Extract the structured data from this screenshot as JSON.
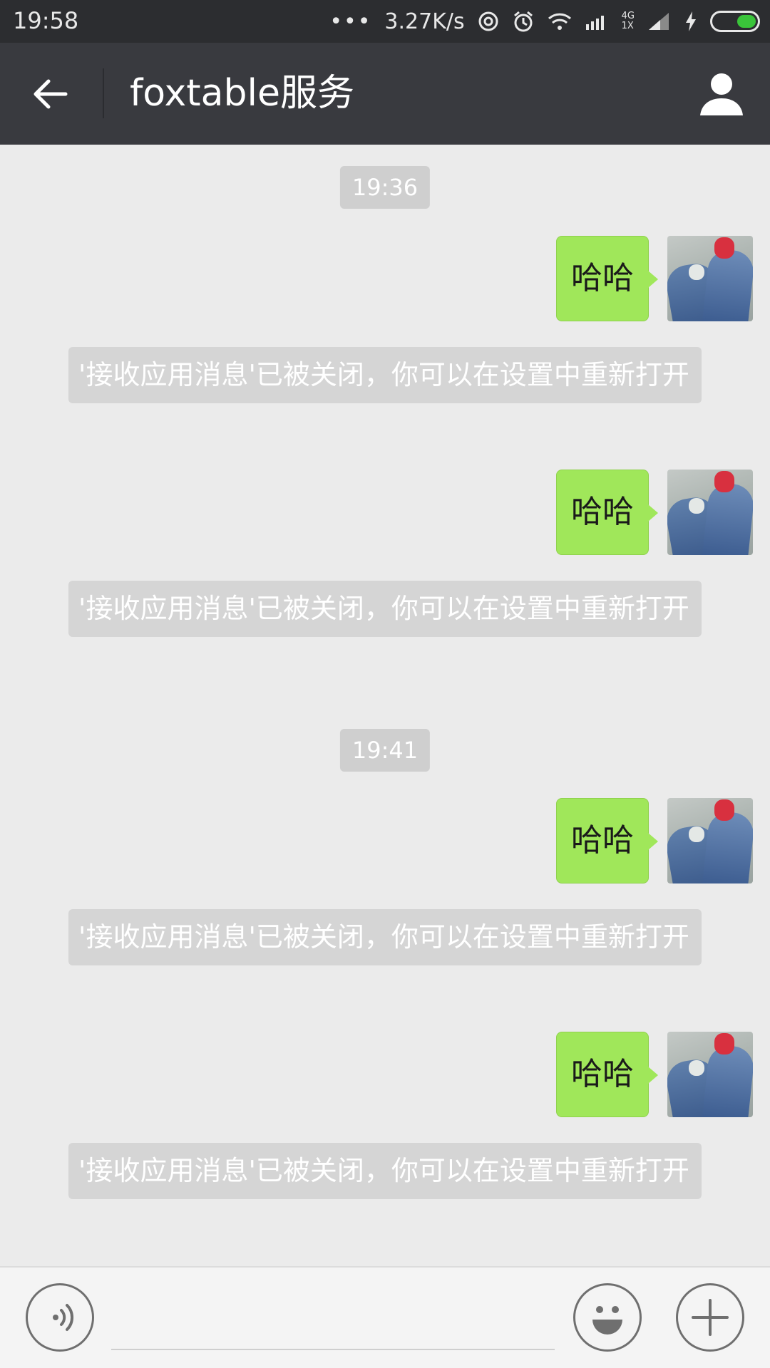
{
  "status_bar": {
    "time": "19:58",
    "dots": "•••",
    "net_speed": "3.27K/s",
    "net_type": "4G",
    "net_sub": "1X"
  },
  "header": {
    "title": "foxtable服务"
  },
  "chat": {
    "timestamps": [
      "19:36",
      "19:41"
    ],
    "messages": [
      {
        "text": "哈哈"
      },
      {
        "note": "'接收应用消息'已被关闭，你可以在设置中重新打开"
      },
      {
        "text": "哈哈"
      },
      {
        "note": "'接收应用消息'已被关闭，你可以在设置中重新打开"
      },
      {
        "text": "哈哈"
      },
      {
        "note": "'接收应用消息'已被关闭，你可以在设置中重新打开"
      },
      {
        "text": "哈哈"
      },
      {
        "note": "'接收应用消息'已被关闭，你可以在设置中重新打开"
      }
    ]
  },
  "input_bar": {
    "message_value": ""
  },
  "colors": {
    "title_bar": "#393a3f",
    "status_bar": "#2c2d30",
    "chat_bg": "#ebebeb",
    "outgoing_bubble": "#a0e75a",
    "system_note": "#d5d5d5"
  },
  "icons": {
    "back": "arrow-left-icon",
    "profile": "person-icon",
    "voice": "voice-icon",
    "emoji": "smile-icon",
    "more": "plus-icon"
  }
}
